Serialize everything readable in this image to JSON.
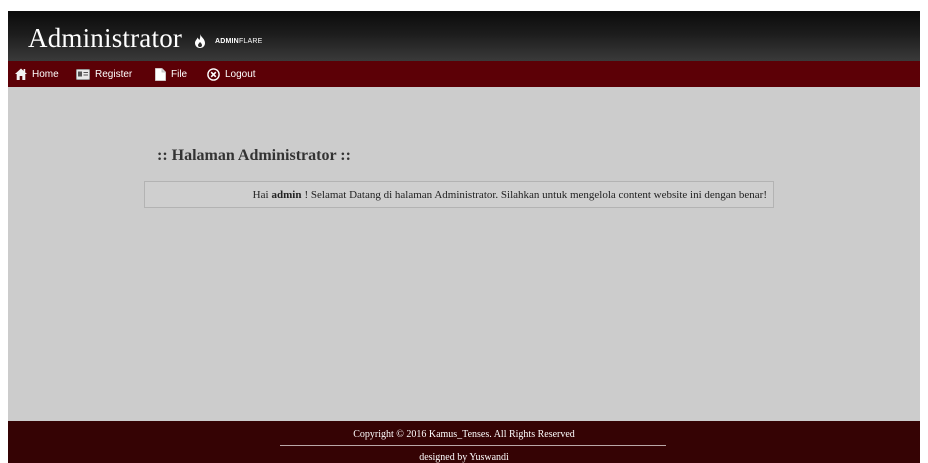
{
  "header": {
    "title": "Administrator",
    "brand_tag_bold": "ADMIN",
    "brand_tag_light": "FLARE",
    "logo_icon": "flame-icon"
  },
  "nav": {
    "items": [
      {
        "label": "Home",
        "icon": "home-icon"
      },
      {
        "label": "Register",
        "icon": "register-card-icon"
      },
      {
        "label": "File",
        "icon": "file-icon"
      },
      {
        "label": "Logout",
        "icon": "logout-circle-x-icon"
      }
    ]
  },
  "main": {
    "page_title": ":: Halaman Administrator ::",
    "welcome_prefix": "Hai",
    "welcome_user": "admin",
    "welcome_suffix": "! Selamat Datang di halaman Administrator. Silahkan untuk mengelola content website ini dengan benar!"
  },
  "footer": {
    "copyright": "Copyright © 2016 Kamus_Tenses. All Rights Reserved",
    "designer": "designed by Yuswandi"
  },
  "colors": {
    "header_dark": "#0b0b0b",
    "nav_background": "#5c0006",
    "content_background": "#cccccc",
    "footer_background": "#350304"
  }
}
